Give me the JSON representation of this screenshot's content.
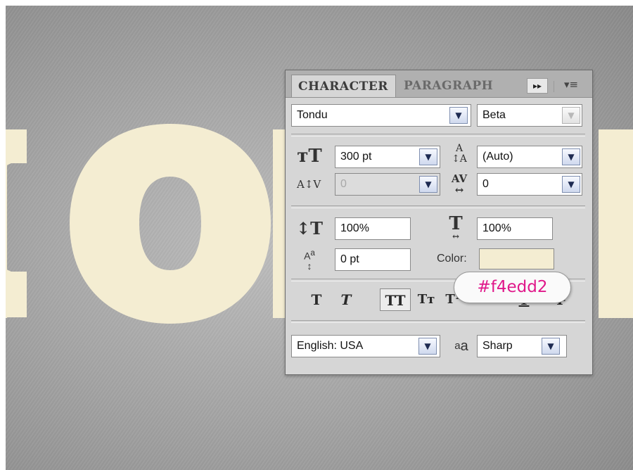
{
  "canvas": {
    "background_color": "#9f9f9f",
    "text_color": "#f4edd2"
  },
  "panel": {
    "tabs": {
      "character": "CHARACTER",
      "paragraph": "PARAGRAPH"
    },
    "fast_forward_icon": "double-arrow-right-icon",
    "menu_icon": "panel-menu-icon",
    "font": {
      "family": "Tondu",
      "style": "Beta"
    },
    "size": {
      "value": "300 pt",
      "icon": "font-size-icon"
    },
    "leading": {
      "value": "(Auto)",
      "icon": "leading-icon"
    },
    "kerning": {
      "value": "0",
      "icon": "kerning-icon"
    },
    "tracking": {
      "value": "0",
      "icon": "tracking-icon"
    },
    "vertical_scale": {
      "value": "100%",
      "icon": "vertical-scale-icon"
    },
    "horizontal_scale": {
      "value": "100%",
      "icon": "horizontal-scale-icon"
    },
    "baseline_shift": {
      "value": "0 pt",
      "icon": "baseline-shift-icon"
    },
    "color": {
      "label": "Color:",
      "swatch": "#f4edd2"
    },
    "style_buttons": [
      {
        "name": "faux-bold",
        "glyph": "T"
      },
      {
        "name": "faux-italic",
        "glyph": "T"
      },
      {
        "name": "all-caps",
        "glyph": "TT"
      },
      {
        "name": "small-caps",
        "glyph": "Tт"
      },
      {
        "name": "superscript",
        "glyph": "T¹"
      },
      {
        "name": "subscript",
        "glyph": "T₁"
      },
      {
        "name": "underline",
        "glyph": "T"
      },
      {
        "name": "strikethrough",
        "glyph": "T"
      }
    ],
    "language": "English: USA",
    "antialias": {
      "icon_text": "aa",
      "value": "Sharp"
    }
  },
  "tooltip": {
    "text": "#f4edd2"
  }
}
